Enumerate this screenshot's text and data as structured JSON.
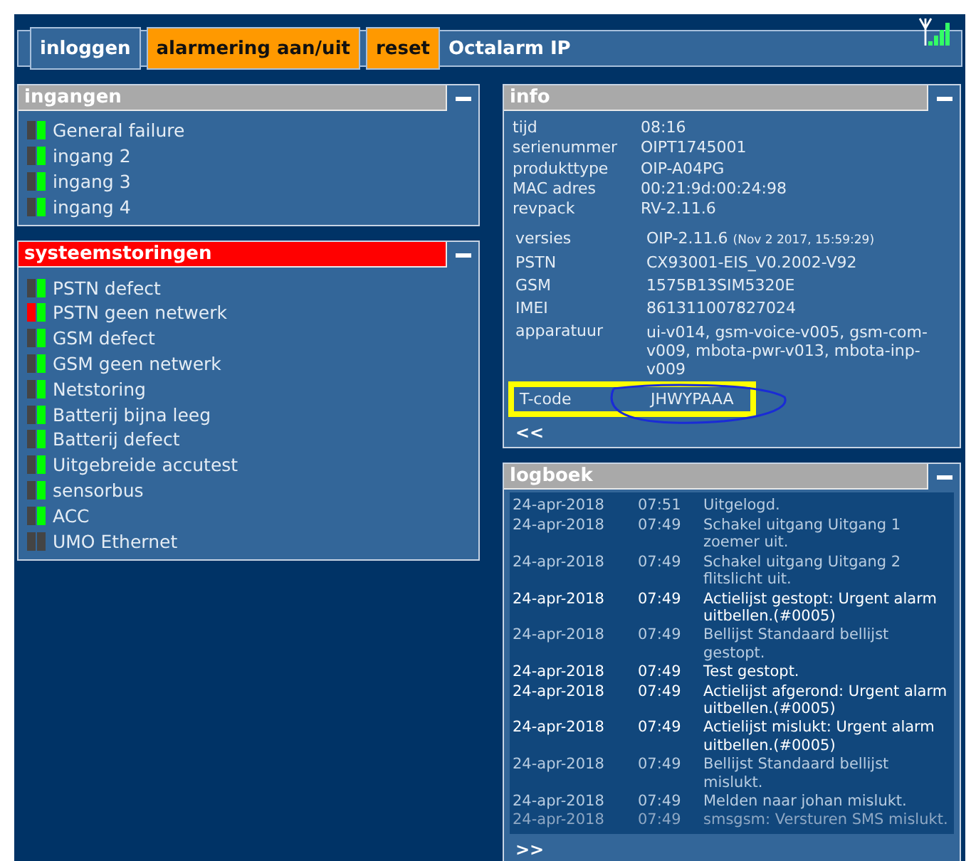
{
  "toolbar": {
    "buttons": [
      {
        "label": "inloggen",
        "kind": "plain"
      },
      {
        "label": "alarmering aan/uit",
        "kind": "action"
      },
      {
        "label": "reset",
        "kind": "action"
      }
    ],
    "title": "Octalarm IP"
  },
  "ingangen": {
    "title": "ingangen",
    "alarm": false,
    "items": [
      {
        "label": "General failure",
        "alarm": false,
        "ok": true
      },
      {
        "label": "ingang 2",
        "alarm": false,
        "ok": true
      },
      {
        "label": "ingang 3",
        "alarm": false,
        "ok": true
      },
      {
        "label": "ingang 4",
        "alarm": false,
        "ok": true
      }
    ]
  },
  "systeemstoringen": {
    "title": "systeemstoringen",
    "alarm": true,
    "items": [
      {
        "label": "PSTN defect",
        "alarm": false,
        "ok": true
      },
      {
        "label": "PSTN geen netwerk",
        "alarm": true,
        "ok": true
      },
      {
        "label": "GSM defect",
        "alarm": false,
        "ok": true
      },
      {
        "label": "GSM geen netwerk",
        "alarm": false,
        "ok": true
      },
      {
        "label": "Netstoring",
        "alarm": false,
        "ok": true
      },
      {
        "label": "Batterij bijna leeg",
        "alarm": false,
        "ok": true
      },
      {
        "label": "Batterij defect",
        "alarm": false,
        "ok": true
      },
      {
        "label": "Uitgebreide accutest",
        "alarm": false,
        "ok": true
      },
      {
        "label": "sensorbus",
        "alarm": false,
        "ok": true
      },
      {
        "label": "ACC",
        "alarm": false,
        "ok": true
      },
      {
        "label": "UMO Ethernet",
        "alarm": false,
        "ok": false
      }
    ]
  },
  "info": {
    "title": "info",
    "rows": [
      {
        "label": "tijd",
        "value": "08:16"
      },
      {
        "label": "serienummer",
        "value": "OIPT1745001"
      },
      {
        "label": "produkttype",
        "value": "OIP-A04PG"
      },
      {
        "label": "MAC adres",
        "value": "00:21:9d:00:24:98"
      },
      {
        "label": "revpack",
        "value": "RV-2.11.6"
      }
    ],
    "versions": [
      {
        "label": "versies",
        "value": "OIP-2.11.6",
        "note": "(Nov 2 2017, 15:59:29)"
      },
      {
        "label": "PSTN",
        "value": "CX93001-EIS_V0.2002-V92"
      },
      {
        "label": "GSM",
        "value": "1575B13SIM5320E"
      },
      {
        "label": "IMEI",
        "value": "861311007827024"
      },
      {
        "label": "apparatuur",
        "value": "ui-v014, gsm-voice-v005, gsm-com-v009, mbota-pwr-v013, mbota-inp-v009"
      }
    ],
    "tcode": {
      "label": "T-code",
      "value": "JHWYPAAA",
      "highlighted": true
    },
    "back": "<<"
  },
  "logboek": {
    "title": "logboek",
    "entries": [
      {
        "date": "24-apr-2018",
        "time": "07:51",
        "message": "Uitgelogd.",
        "kind": "normal"
      },
      {
        "date": "24-apr-2018",
        "time": "07:49",
        "message": "Schakel uitgang Uitgang 1 zoemer uit.",
        "kind": "normal"
      },
      {
        "date": "24-apr-2018",
        "time": "07:49",
        "message": "Schakel uitgang Uitgang 2 flitslicht uit.",
        "kind": "normal"
      },
      {
        "date": "24-apr-2018",
        "time": "07:49",
        "message": "Actielijst gestopt: Urgent alarm uitbellen.(#0005)",
        "kind": "important"
      },
      {
        "date": "24-apr-2018",
        "time": "07:49",
        "message": "Bellijst Standaard bellijst gestopt.",
        "kind": "normal"
      },
      {
        "date": "24-apr-2018",
        "time": "07:49",
        "message": "Test gestopt.",
        "kind": "important"
      },
      {
        "date": "24-apr-2018",
        "time": "07:49",
        "message": "Actielijst afgerond: Urgent alarm uitbellen.(#0005)",
        "kind": "important"
      },
      {
        "date": "24-apr-2018",
        "time": "07:49",
        "message": "Actielijst mislukt: Urgent alarm uitbellen.(#0005)",
        "kind": "important"
      },
      {
        "date": "24-apr-2018",
        "time": "07:49",
        "message": "Bellijst Standaard bellijst mislukt.",
        "kind": "normal"
      },
      {
        "date": "24-apr-2018",
        "time": "07:49",
        "message": "Melden naar johan mislukt.",
        "kind": "normal"
      },
      {
        "date": "24-apr-2018",
        "time": "07:49",
        "message": "smsgsm: Versturen SMS mislukt.",
        "kind": "faded"
      }
    ],
    "more": ">>"
  }
}
